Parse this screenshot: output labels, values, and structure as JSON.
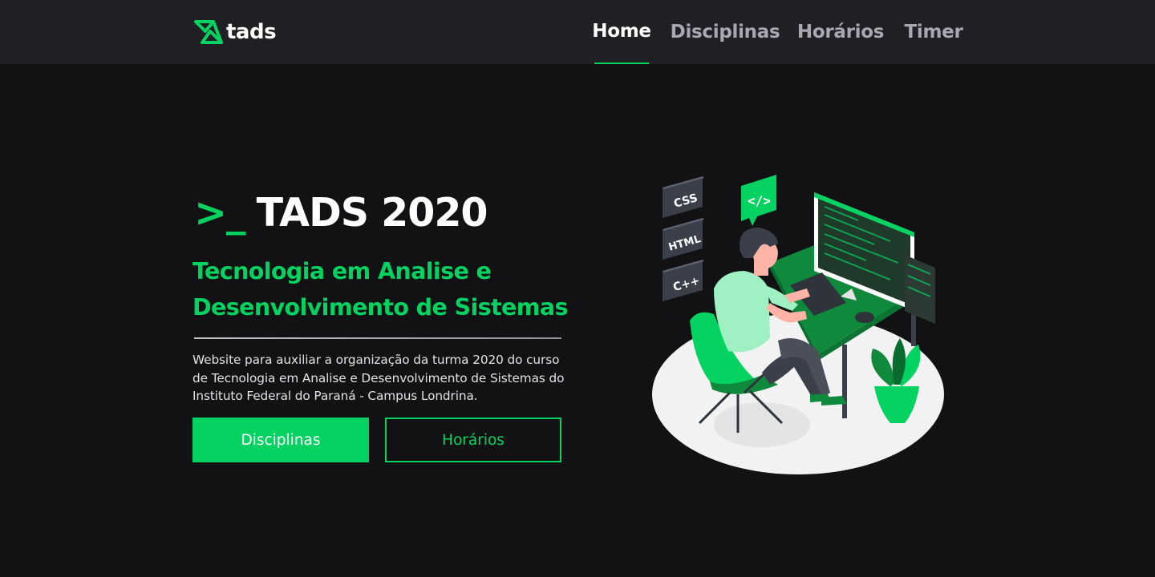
{
  "brand": {
    "name": "tads",
    "accent": "#04d361"
  },
  "nav": {
    "items": [
      {
        "label": "Home",
        "active": true
      },
      {
        "label": "Disciplinas",
        "active": false
      },
      {
        "label": "Horários",
        "active": false
      },
      {
        "label": "Timer",
        "active": false
      }
    ]
  },
  "hero": {
    "prompt": ">_",
    "title": "TADS 2020",
    "subtitle": "Tecnologia em Analise e Desenvolvimento de Sistemas",
    "description": "Website para auxiliar a organização da turma 2020 do curso de Tecnologia em Analise e Desenvolvimento de Sistemas do Instituto Federal do Paraná - Campus Londrina.",
    "primary_button": "Disciplinas",
    "secondary_button": "Horários"
  },
  "illustration": {
    "tags": [
      "CSS",
      "HTML",
      "C++"
    ],
    "code_badge": "</>"
  },
  "colors": {
    "background": "#121214",
    "header": "#202024",
    "accent": "#04d361"
  }
}
